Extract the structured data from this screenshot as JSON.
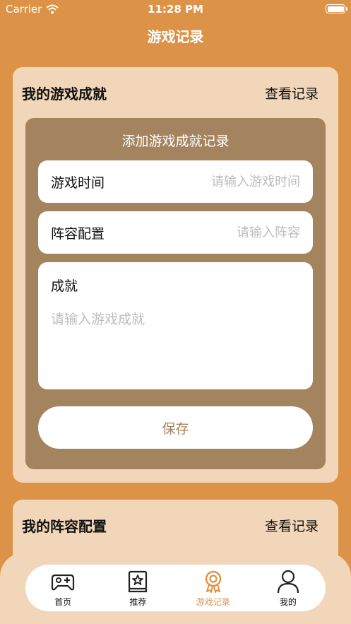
{
  "status_bar": {
    "carrier": "Carrier",
    "time": "11:28 PM"
  },
  "nav": {
    "title": "游戏记录"
  },
  "achievements_card": {
    "title": "我的游戏成就",
    "link": "查看记录",
    "form": {
      "heading": "添加游戏成就记录",
      "time_field": {
        "label": "游戏时间",
        "placeholder": "请输入游戏时间",
        "value": ""
      },
      "lineup_field": {
        "label": "阵容配置",
        "placeholder": "请输入阵容",
        "value": ""
      },
      "achievement_field": {
        "label": "成就",
        "placeholder": "请输入游戏成就",
        "value": ""
      },
      "save_label": "保存"
    }
  },
  "lineup_card": {
    "title": "我的阵容配置",
    "link": "查看记录"
  },
  "tabs": [
    {
      "label": "首页",
      "icon": "gamepad-icon",
      "active": false
    },
    {
      "label": "推荐",
      "icon": "star-book-icon",
      "active": false
    },
    {
      "label": "游戏记录",
      "icon": "medal-icon",
      "active": true
    },
    {
      "label": "我的",
      "icon": "person-icon",
      "active": false
    }
  ],
  "colors": {
    "background": "#dc9247",
    "card": "#f2d6b9",
    "panel": "#a4835f",
    "active_tab": "#dc9247"
  }
}
